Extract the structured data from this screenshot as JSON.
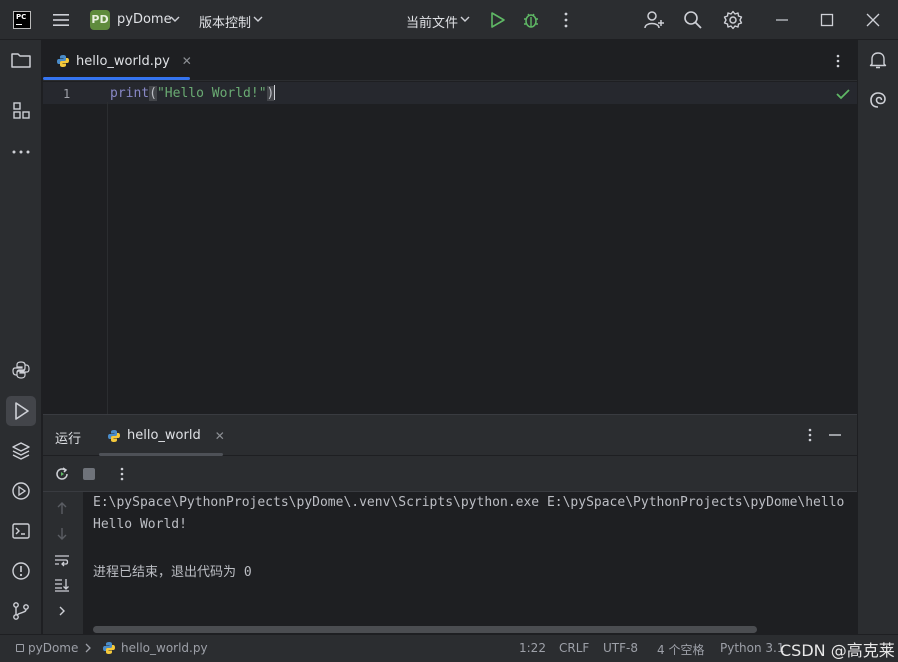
{
  "titlebar": {
    "logo_text": "PC",
    "project_badge": "PD",
    "project_name": "pyDome",
    "vcs_label": "版本控制",
    "run_config": "当前文件"
  },
  "editor": {
    "tab_label": "hello_world.py",
    "line_numbers": [
      "1"
    ],
    "code": {
      "func": "print",
      "open": "(",
      "string": "\"Hello World!\"",
      "close": ")"
    }
  },
  "run_panel": {
    "title": "运行",
    "tab_label": "hello_world",
    "console_lines": [
      "E:\\pySpace\\PythonProjects\\pyDome\\.venv\\Scripts\\python.exe E:\\pySpace\\PythonProjects\\pyDome\\hello",
      "Hello World!",
      "",
      "进程已结束，退出代码为 0"
    ]
  },
  "statusbar": {
    "breadcrumb_project": "pyDome",
    "breadcrumb_file": "hello_world.py",
    "position": "1:22",
    "line_sep": "CRLF",
    "encoding": "UTF-8",
    "indent": "4 个空格",
    "interpreter": "Python 3.1",
    "watermark": "CSDN @高克莱"
  },
  "colors": {
    "accent": "#3574f0",
    "run_green": "#5fb865",
    "string_green": "#6aab73",
    "keyword": "#8888c6"
  }
}
